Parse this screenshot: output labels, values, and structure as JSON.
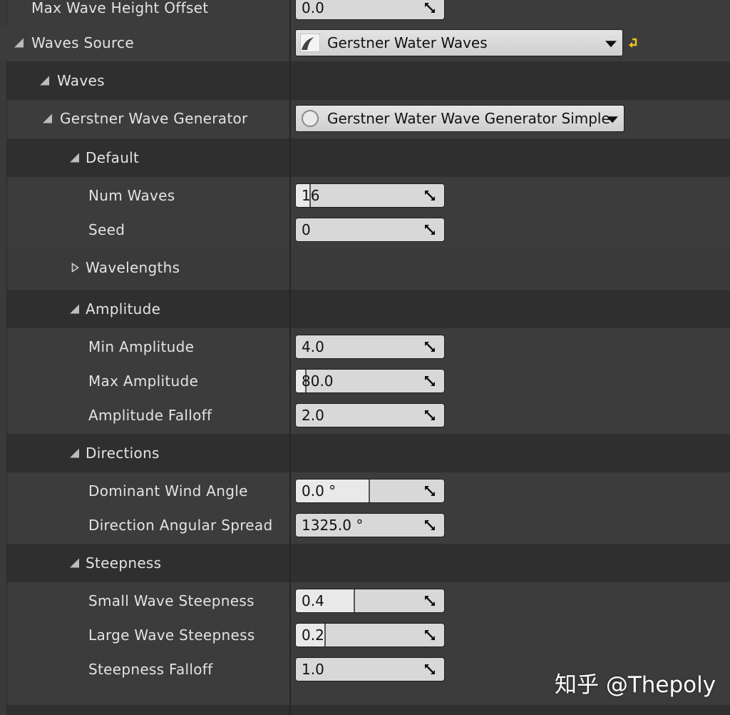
{
  "properties": {
    "max_wave_height_offset": {
      "label": "Max Wave Height Offset",
      "value": "0.0"
    },
    "waves_source": {
      "label": "Waves Source",
      "value": "Gerstner Water Waves"
    },
    "waves": {
      "label": "Waves"
    },
    "gerstner_wave_generator": {
      "label": "Gerstner Wave Generator",
      "value": "Gerstner Water Wave Generator Simple"
    },
    "default": {
      "label": "Default"
    },
    "num_waves": {
      "label": "Num Waves",
      "value": "16"
    },
    "seed": {
      "label": "Seed",
      "value": "0"
    },
    "wavelengths": {
      "label": "Wavelengths"
    },
    "amplitude": {
      "label": "Amplitude"
    },
    "min_amplitude": {
      "label": "Min Amplitude",
      "value": "4.0"
    },
    "max_amplitude": {
      "label": "Max Amplitude",
      "value": "80.0"
    },
    "amplitude_falloff": {
      "label": "Amplitude Falloff",
      "value": "2.0"
    },
    "directions": {
      "label": "Directions"
    },
    "dominant_wind_angle": {
      "label": "Dominant Wind Angle",
      "value": "0.0 °"
    },
    "direction_angular_spread": {
      "label": "Direction Angular Spread",
      "value": "1325.0 °"
    },
    "steepness": {
      "label": "Steepness"
    },
    "small_wave_steepness": {
      "label": "Small Wave Steepness",
      "value": "0.4"
    },
    "large_wave_steepness": {
      "label": "Large Wave Steepness",
      "value": "0.2"
    },
    "steepness_falloff": {
      "label": "Steepness Falloff",
      "value": "1.0"
    }
  },
  "slider_fill": {
    "num_waves": 0.1,
    "max_amplitude": 0.07,
    "dominant_wind_angle": 0.5,
    "small_wave_steepness": 0.4,
    "large_wave_steepness": 0.2
  },
  "watermark": "知乎 @Thepoly",
  "colors": {
    "panel_bg": "#3c3c3c",
    "category_bg": "#2f2f2f",
    "field_bg": "#d8d8d8",
    "reset_arrow": "#e8c21f"
  }
}
